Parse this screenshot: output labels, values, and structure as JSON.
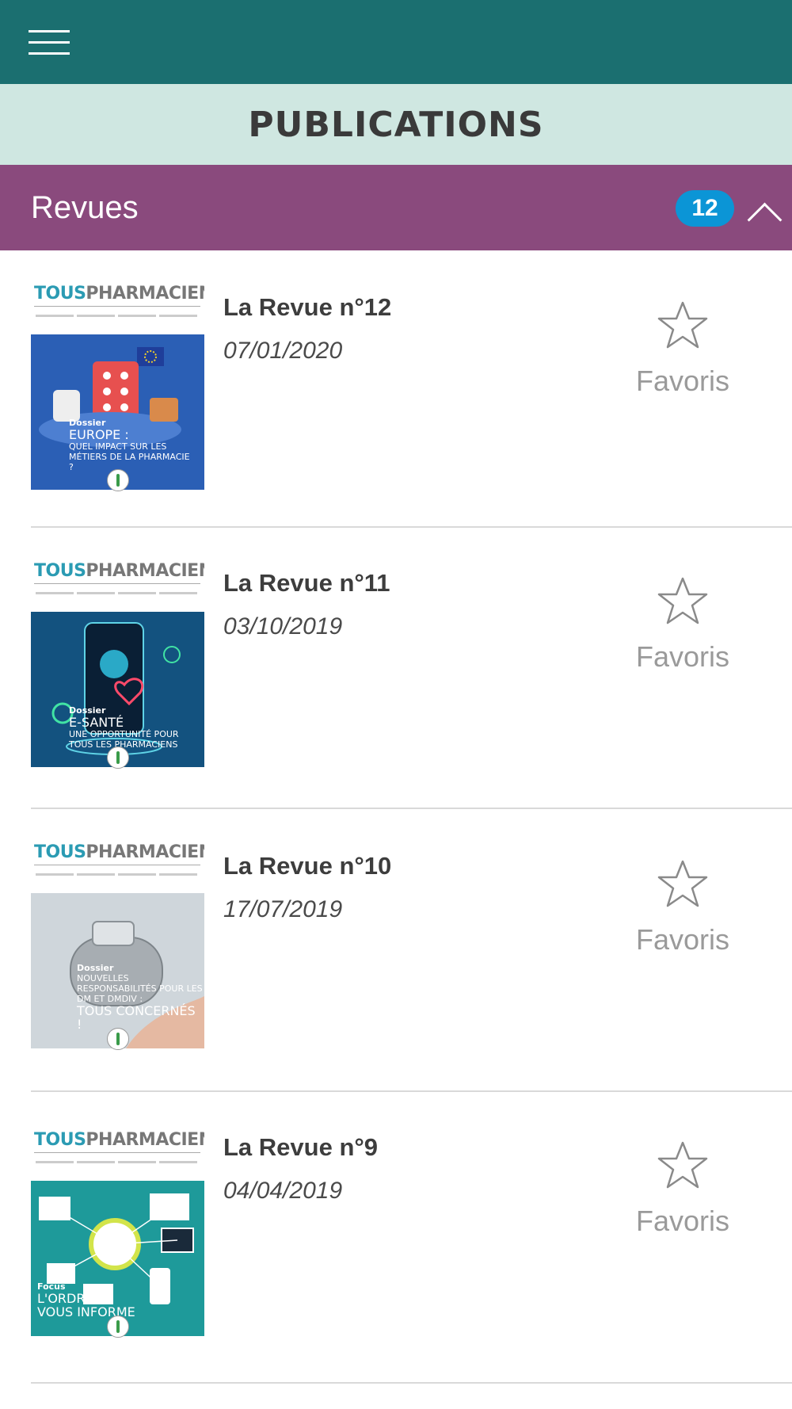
{
  "header": {
    "title": "PUBLICATIONS",
    "menu_icon": "hamburger-menu-icon"
  },
  "section": {
    "title": "Revues",
    "count": "12",
    "toggle_icon": "chevron-up-icon"
  },
  "colors": {
    "topbar": "#1b6f70",
    "titlebar": "#cfe7e1",
    "section": "#8a4a7d",
    "badge": "#0b95d6",
    "favoris": "#9a9a9a"
  },
  "cover_brand": {
    "tous": "TOUS",
    "pharmaciens": "PHARMACIENS"
  },
  "items": [
    {
      "title": "La Revue n°12",
      "date": "07/01/2020",
      "favoris": "Favoris",
      "cover": {
        "kicker": "Dossier",
        "headline": "EUROPE :",
        "sub": "QUEL IMPACT SUR LES MÉTIERS DE LA PHARMACIE ?"
      }
    },
    {
      "title": "La Revue n°11",
      "date": "03/10/2019",
      "favoris": "Favoris",
      "cover": {
        "kicker": "Dossier",
        "headline": "E-SANTÉ",
        "sub": "UNE OPPORTUNITÉ POUR TOUS LES PHARMACIENS"
      }
    },
    {
      "title": "La Revue n°10",
      "date": "17/07/2019",
      "favoris": "Favoris",
      "cover": {
        "kicker": "Dossier",
        "headline": "TOUS CONCERNÉS !",
        "sub": "NOUVELLES RESPONSABILITÉS POUR LES DM ET DMDIV :"
      }
    },
    {
      "title": "La Revue n°9",
      "date": "04/04/2019",
      "favoris": "Favoris",
      "cover": {
        "kicker": "Focus",
        "headline": "L'ORDRE",
        "sub": "VOUS INFORME"
      }
    }
  ]
}
